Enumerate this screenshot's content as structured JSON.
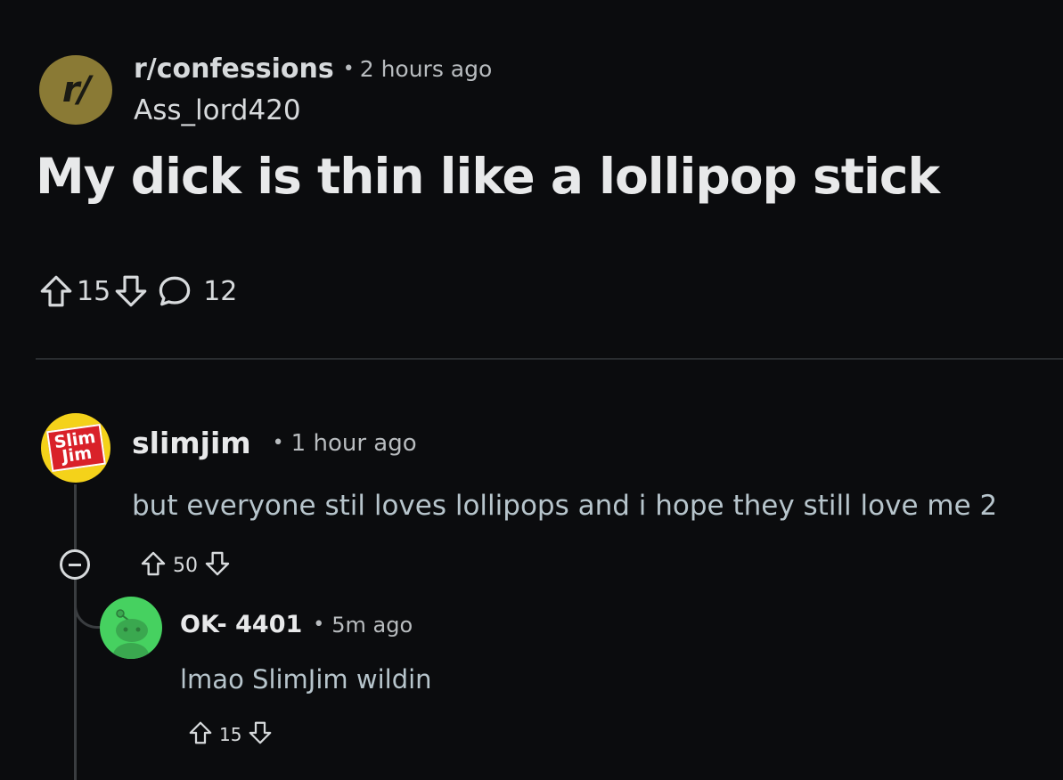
{
  "post": {
    "subreddit": "r/confessions",
    "subreddit_icon_text": "r/",
    "time": "2 hours ago",
    "author": "Ass_lord420",
    "title": "My dick is thin like a lollipop stick",
    "upvotes": "15",
    "comments": "12",
    "separator": "•"
  },
  "comments": [
    {
      "username": "slimjim",
      "avatar_text": "Slim Jim",
      "time": "1 hour ago",
      "body": "but everyone stil loves lollipops and i hope they still love me 2",
      "votes": "50",
      "separator": "•"
    },
    {
      "username": "OK- 4401",
      "time": "5m ago",
      "body": "lmao SlimJim wildin",
      "votes": "15",
      "separator": "•"
    }
  ],
  "icons": {
    "upvote": "upvote-arrow-icon",
    "downvote": "downvote-arrow-icon",
    "comment": "comment-bubble-icon",
    "collapse": "collapse-minus-icon"
  },
  "colors": {
    "background": "#0b0c0e",
    "text": "#d7dadc",
    "body_text": "#b7c5cc",
    "subreddit_icon": "#8a7a35",
    "slimjim_avatar": "#f4d21a",
    "snoo_avatar": "#46d160"
  }
}
